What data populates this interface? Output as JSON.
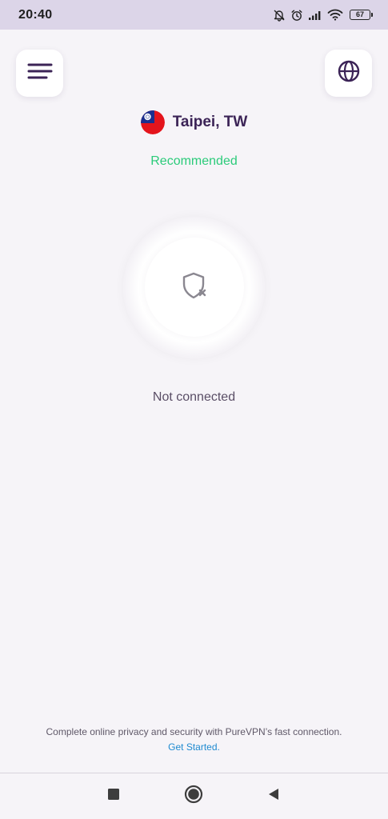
{
  "status_bar": {
    "time": "20:40",
    "battery": "67",
    "icons": [
      "bell-off-icon",
      "alarm-icon",
      "signal-icon",
      "wifi-icon",
      "battery-icon"
    ]
  },
  "header": {
    "menu_icon": "hamburger-menu-icon",
    "globe_icon": "globe-icon"
  },
  "location": {
    "flag_icon": "taiwan-flag-icon",
    "name": "Taipei, TW",
    "tag": "Recommended"
  },
  "connection": {
    "icon": "shield-x-icon",
    "status": "Not connected"
  },
  "footer": {
    "promo": "Complete online privacy and security with PureVPN’s fast connection.",
    "cta": "Get Started."
  },
  "nav": {
    "recent_icon": "square-recent-icon",
    "home_icon": "circle-home-icon",
    "back_icon": "triangle-back-icon"
  },
  "colors": {
    "background": "#f6f4f8",
    "status_bar": "#dcd5e8",
    "primary_text": "#3b2356",
    "recommended": "#2bcb7a",
    "link": "#1f8ad0"
  }
}
